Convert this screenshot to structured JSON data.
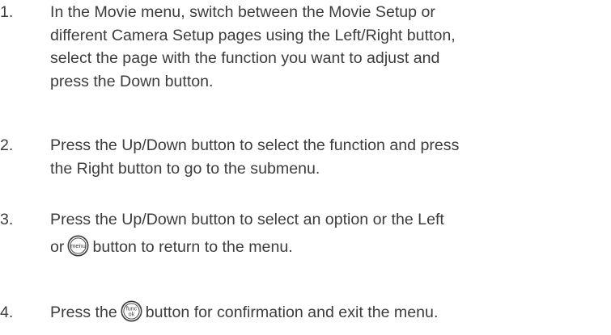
{
  "steps": [
    {
      "number": "1.",
      "lines": [
        "In the Movie menu, switch between the Movie Setup or",
        "different Camera Setup pages using the Left/Right button,",
        "select the page with the function you want to adjust and",
        "press the Down button."
      ]
    },
    {
      "number": "2.",
      "lines": [
        "Press the Up/Down button to select the function and press",
        "the Right button to go to the submenu."
      ]
    },
    {
      "number": "3.",
      "line1": "Press the Up/Down button to select an option or the Left",
      "line2_before": "or",
      "icon_label": "menu",
      "line2_after": "button to return to the menu."
    },
    {
      "number": "4.",
      "before": "Press the",
      "icon_label_top": "func",
      "icon_label_bottom": "ok",
      "after": "button for confirmation and exit the menu."
    }
  ],
  "icons": {
    "menu_button": "menu-button-icon",
    "func_ok_button": "func-ok-button-icon"
  }
}
